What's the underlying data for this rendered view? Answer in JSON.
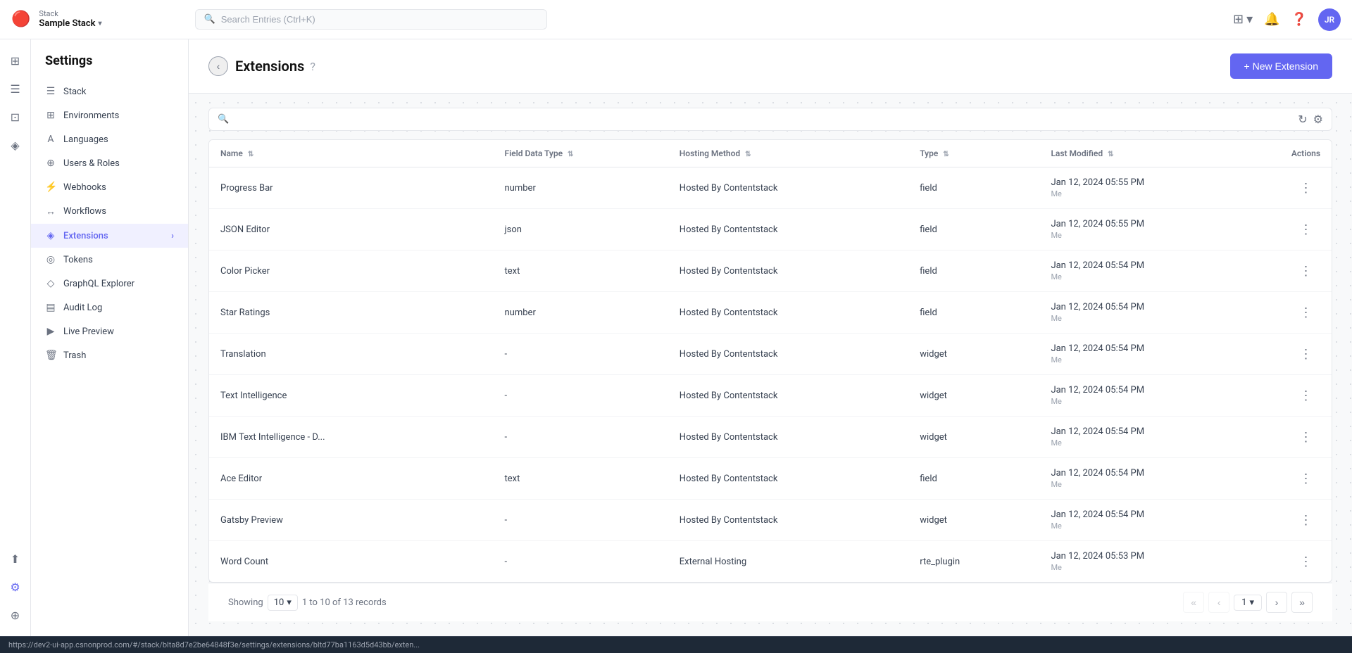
{
  "app": {
    "title": "Stack",
    "stack_name": "Sample Stack"
  },
  "topnav": {
    "search_placeholder": "Search Entries (Ctrl+K)",
    "avatar_initials": "JR"
  },
  "sidebar": {
    "title": "Settings",
    "items": [
      {
        "id": "stack",
        "label": "Stack",
        "icon": "☰"
      },
      {
        "id": "environments",
        "label": "Environments",
        "icon": "⊞"
      },
      {
        "id": "languages",
        "label": "Languages",
        "icon": "A"
      },
      {
        "id": "users-roles",
        "label": "Users & Roles",
        "icon": "⊕"
      },
      {
        "id": "webhooks",
        "label": "Webhooks",
        "icon": "⚡"
      },
      {
        "id": "workflows",
        "label": "Workflows",
        "icon": "↔"
      },
      {
        "id": "extensions",
        "label": "Extensions",
        "icon": "◈",
        "active": true
      },
      {
        "id": "tokens",
        "label": "Tokens",
        "icon": "◎"
      },
      {
        "id": "graphql-explorer",
        "label": "GraphQL Explorer",
        "icon": "◇"
      },
      {
        "id": "audit-log",
        "label": "Audit Log",
        "icon": "▤"
      },
      {
        "id": "live-preview",
        "label": "Live Preview",
        "icon": "▶"
      },
      {
        "id": "trash",
        "label": "Trash",
        "icon": "🗑"
      }
    ]
  },
  "page": {
    "title": "Extensions",
    "new_button_label": "+ New Extension"
  },
  "table": {
    "columns": [
      {
        "id": "name",
        "label": "Name"
      },
      {
        "id": "field_data_type",
        "label": "Field Data Type"
      },
      {
        "id": "hosting_method",
        "label": "Hosting Method"
      },
      {
        "id": "type",
        "label": "Type"
      },
      {
        "id": "last_modified",
        "label": "Last Modified"
      },
      {
        "id": "actions",
        "label": "Actions"
      }
    ],
    "rows": [
      {
        "name": "Progress Bar",
        "field_data_type": "number",
        "hosting_method": "Hosted By Contentstack",
        "type": "field",
        "last_modified": "Jan 12, 2024 05:55 PM",
        "modified_by": "Me"
      },
      {
        "name": "JSON Editor",
        "field_data_type": "json",
        "hosting_method": "Hosted By Contentstack",
        "type": "field",
        "last_modified": "Jan 12, 2024 05:55 PM",
        "modified_by": "Me"
      },
      {
        "name": "Color Picker",
        "field_data_type": "text",
        "hosting_method": "Hosted By Contentstack",
        "type": "field",
        "last_modified": "Jan 12, 2024 05:54 PM",
        "modified_by": "Me"
      },
      {
        "name": "Star Ratings",
        "field_data_type": "number",
        "hosting_method": "Hosted By Contentstack",
        "type": "field",
        "last_modified": "Jan 12, 2024 05:54 PM",
        "modified_by": "Me"
      },
      {
        "name": "Translation",
        "field_data_type": "-",
        "hosting_method": "Hosted By Contentstack",
        "type": "widget",
        "last_modified": "Jan 12, 2024 05:54 PM",
        "modified_by": "Me"
      },
      {
        "name": "Text Intelligence",
        "field_data_type": "-",
        "hosting_method": "Hosted By Contentstack",
        "type": "widget",
        "last_modified": "Jan 12, 2024 05:54 PM",
        "modified_by": "Me"
      },
      {
        "name": "IBM Text Intelligence - D...",
        "field_data_type": "-",
        "hosting_method": "Hosted By Contentstack",
        "type": "widget",
        "last_modified": "Jan 12, 2024 05:54 PM",
        "modified_by": "Me"
      },
      {
        "name": "Ace Editor",
        "field_data_type": "text",
        "hosting_method": "Hosted By Contentstack",
        "type": "field",
        "last_modified": "Jan 12, 2024 05:54 PM",
        "modified_by": "Me"
      },
      {
        "name": "Gatsby Preview",
        "field_data_type": "-",
        "hosting_method": "Hosted By Contentstack",
        "type": "widget",
        "last_modified": "Jan 12, 2024 05:54 PM",
        "modified_by": "Me"
      },
      {
        "name": "Word Count",
        "field_data_type": "-",
        "hosting_method": "External Hosting",
        "type": "rte_plugin",
        "last_modified": "Jan 12, 2024 05:53 PM",
        "modified_by": "Me"
      }
    ]
  },
  "pagination": {
    "showing_label": "Showing",
    "per_page": "10",
    "records_label": "1 to 10 of 13 records",
    "current_page": "1"
  },
  "statusbar": {
    "url": "https://dev2-ui-app.csnonprod.com/#/stack/blta8d7e2be64848f3e/settings/extensions/bltd77ba1163d5d43bb/exten..."
  }
}
